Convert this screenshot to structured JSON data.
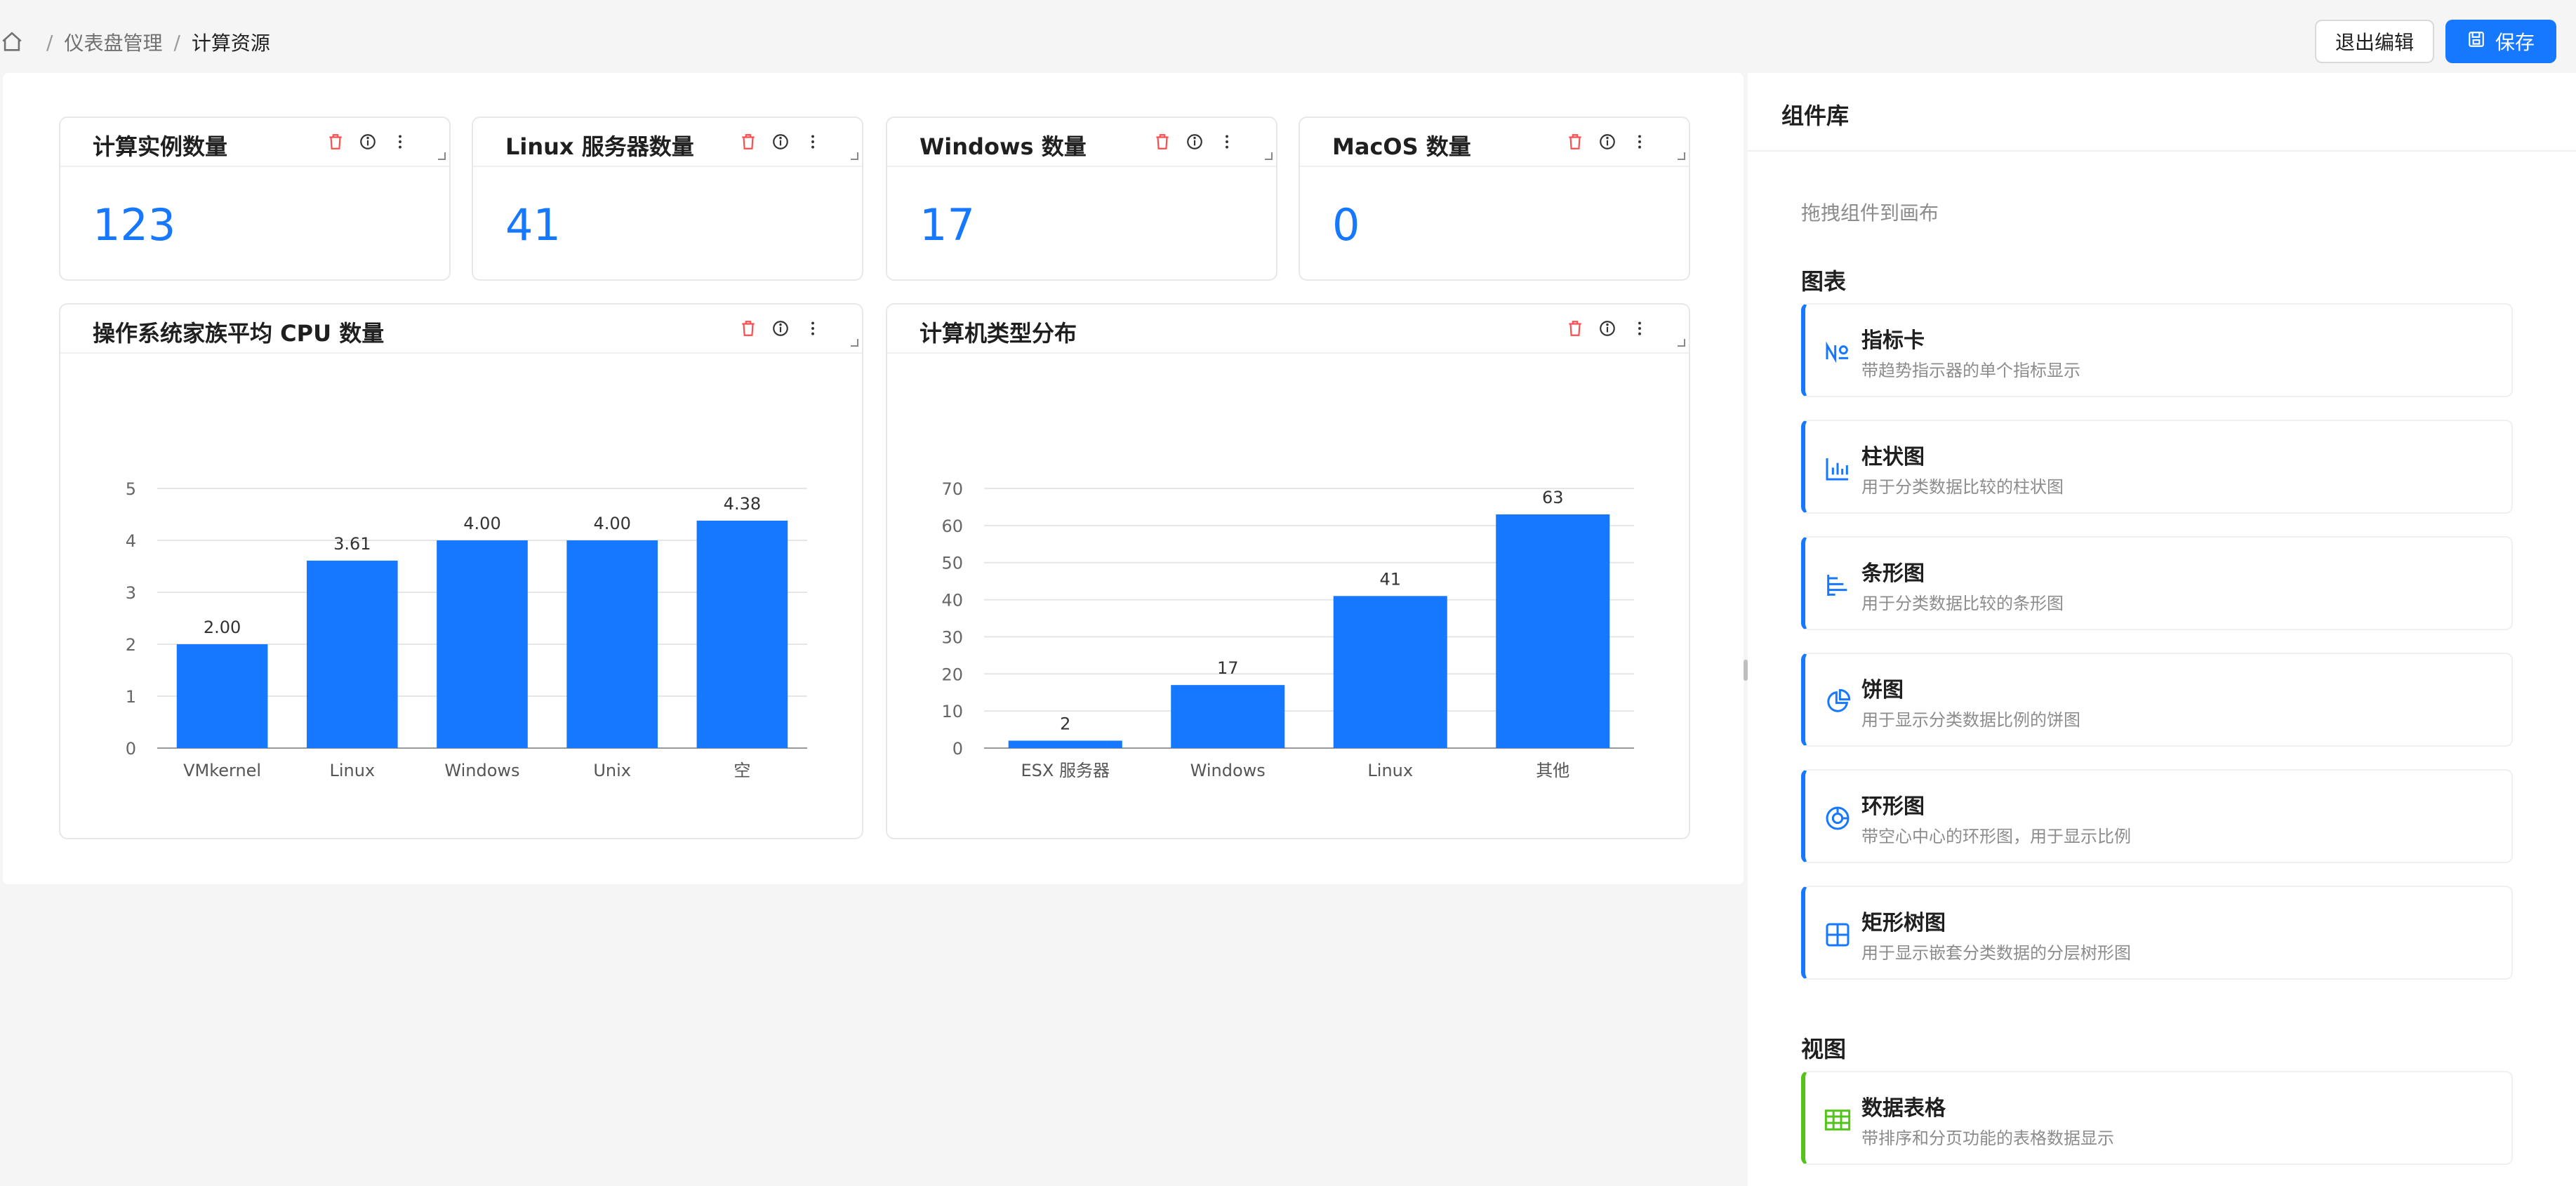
{
  "breadcrumb": {
    "items": [
      "仪表盘管理",
      "计算资源"
    ]
  },
  "toolbar": {
    "exit_label": "退出编辑",
    "save_label": "保存"
  },
  "colors": {
    "accent": "#1677ff",
    "danger": "#ff4d4f",
    "view_accent": "#52c41a"
  },
  "metrics": [
    {
      "title": "计算实例数量",
      "value": "123"
    },
    {
      "title": "Linux 服务器数量",
      "value": "41"
    },
    {
      "title": "Windows 数量",
      "value": "17"
    },
    {
      "title": "MacOS 数量",
      "value": "0"
    }
  ],
  "chart_data": [
    {
      "type": "bar",
      "title": "操作系统家族平均 CPU 数量",
      "categories": [
        "VMkernel",
        "Linux",
        "Windows",
        "Unix",
        "空"
      ],
      "values": [
        2.0,
        3.61,
        4.0,
        4.0,
        4.38
      ],
      "value_labels": [
        "2.00",
        "3.61",
        "4.00",
        "4.00",
        "4.38"
      ],
      "ylim": [
        0,
        5
      ],
      "yticks": [
        "0",
        "1",
        "2",
        "3",
        "4",
        "5"
      ],
      "grid": true
    },
    {
      "type": "bar",
      "title": "计算机类型分布",
      "categories": [
        "ESX 服务器",
        "Windows",
        "Linux",
        "其他"
      ],
      "values": [
        2,
        17,
        41,
        63
      ],
      "value_labels": [
        "2",
        "17",
        "41",
        "63"
      ],
      "ylim": [
        0,
        70
      ],
      "yticks": [
        "0",
        "10",
        "20",
        "30",
        "40",
        "50",
        "60",
        "70"
      ],
      "grid": true
    }
  ],
  "library": {
    "title": "组件库",
    "hint": "拖拽组件到画布",
    "sections": [
      {
        "title": "图表",
        "items": [
          {
            "name": "指标卡",
            "desc": "带趋势指示器的单个指标显示",
            "icon": "number-icon"
          },
          {
            "name": "柱状图",
            "desc": "用于分类数据比较的柱状图",
            "icon": "bar-chart-icon"
          },
          {
            "name": "条形图",
            "desc": "用于分类数据比较的条形图",
            "icon": "horizontal-bar-icon"
          },
          {
            "name": "饼图",
            "desc": "用于显示分类数据比例的饼图",
            "icon": "pie-chart-icon"
          },
          {
            "name": "环形图",
            "desc": "带空心中心的环形图，用于显示比例",
            "icon": "donut-chart-icon"
          },
          {
            "name": "矩形树图",
            "desc": "用于显示嵌套分类数据的分层树形图",
            "icon": "treemap-icon"
          }
        ]
      },
      {
        "title": "视图",
        "items": [
          {
            "name": "数据表格",
            "desc": "带排序和分页功能的表格数据显示",
            "icon": "table-icon"
          }
        ]
      }
    ]
  }
}
